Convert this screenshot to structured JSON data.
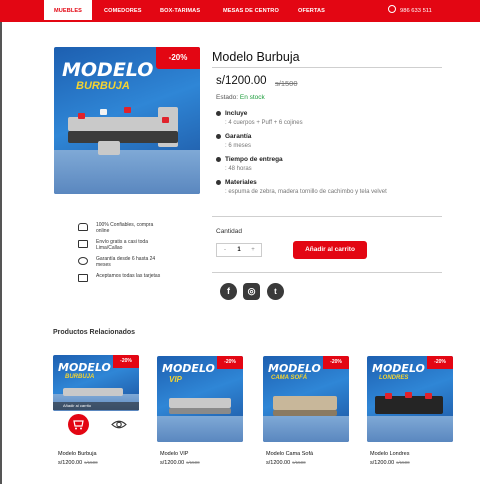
{
  "nav": {
    "items": [
      "MUEBLES",
      "COMEDORES",
      "BOX-TARIMAS",
      "MESAS DE CENTRO",
      "OFERTAS"
    ],
    "phone": "986 633 511",
    "colors": {
      "brand_red": "#e30613"
    }
  },
  "product": {
    "image_title": "MODELO",
    "image_subtitle": "BURBUJA",
    "discount_badge": "-20%",
    "name": "Modelo Burbuja",
    "price": "s/1200.00",
    "old_price": "s/1500",
    "status_label": "Estado:",
    "status_value": "En stock",
    "features": [
      {
        "title": "Incluye",
        "value": ": 4 cuerpos + Puff + 6 cojines"
      },
      {
        "title": "Garantía",
        "value": ": 6 meses"
      },
      {
        "title": "Tiempo de entrega",
        "value": ": 48 horas"
      },
      {
        "title": "Materiales",
        "value": ": espuma de zebra, madera tornillo de cachimbo y tela velvet"
      }
    ],
    "quantity_label": "Cantidad",
    "quantity_value": "1",
    "minus": "-",
    "plus": "+",
    "add_to_cart": "Añadir al carrito"
  },
  "benefits": [
    {
      "icon": "thumbs-up-icon",
      "text": "100% Confiables, compra online"
    },
    {
      "icon": "truck-icon",
      "text": "Envío gratis a casi toda Lima/Callao"
    },
    {
      "icon": "shield-icon",
      "text": "Garantía desde 6 hasta 24 meses"
    },
    {
      "icon": "credit-card-icon",
      "text": "Aceptamos todas las tarjetas"
    }
  ],
  "social": [
    "facebook-icon",
    "instagram-icon",
    "twitter-icon"
  ],
  "related": {
    "title": "Productos Relacionados",
    "add_to_cart_overlay": "Añadir al carrito",
    "items": [
      {
        "image_title": "MODELO",
        "image_subtitle": "BURBUJA",
        "badge": "-20%",
        "name": "Modelo Burbuja",
        "price": "s/1200.00",
        "old_price": "s/1500"
      },
      {
        "image_title": "MODELO",
        "image_subtitle": "VIP",
        "badge": "-20%",
        "name": "Modelo VIP",
        "price": "s/1200.00",
        "old_price": "s/1500"
      },
      {
        "image_title": "MODELO",
        "image_subtitle": "CAMA SOFÁ",
        "badge": "-20%",
        "name": "Modelo Cama Sofá",
        "price": "s/1200.00",
        "old_price": "s/1500"
      },
      {
        "image_title": "MODELO",
        "image_subtitle": "LONDRES",
        "badge": "-20%",
        "name": "Modelo Londres",
        "price": "s/1200.00",
        "old_price": "s/1500"
      }
    ]
  }
}
